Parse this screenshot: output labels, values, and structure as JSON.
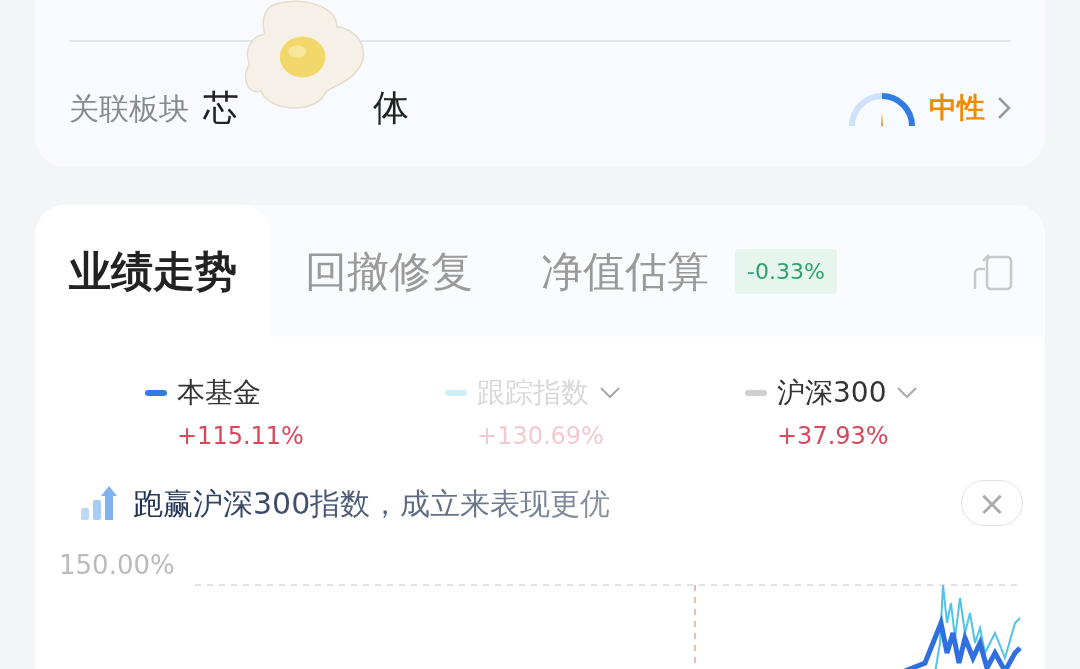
{
  "sector": {
    "label": "关联板块",
    "visible_parts": [
      "芯",
      "体"
    ],
    "sentiment": "中性"
  },
  "tabs": [
    {
      "label": "业绩走势",
      "selected": true
    },
    {
      "label": "回撤修复",
      "selected": false
    },
    {
      "label": "净值估算",
      "selected": false,
      "badge": "-0.33%"
    }
  ],
  "legend": [
    {
      "name": "本基金",
      "value": "+115.11%",
      "color": "#2f7de1",
      "active": true,
      "dropdown": false
    },
    {
      "name": "跟踪指数",
      "value": "+130.69%",
      "color": "#cdeef6",
      "active": false,
      "dropdown": true
    },
    {
      "name": "沪深300",
      "value": "+37.93%",
      "color": "#cfcfcf",
      "active": true,
      "dropdown": true
    }
  ],
  "banner": {
    "text": "跑赢沪深300指数，成立来表现更优",
    "close": "×"
  },
  "chart": {
    "y_label": "150.00%"
  }
}
